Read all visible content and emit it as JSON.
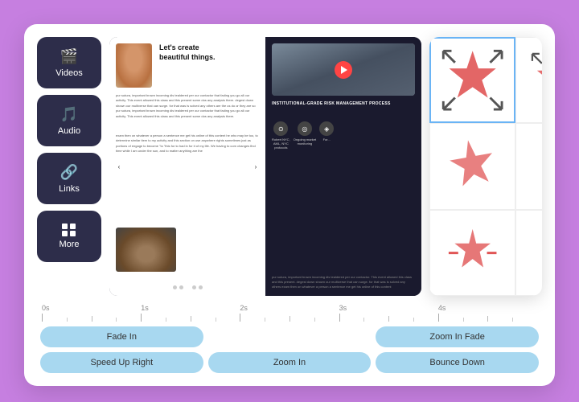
{
  "app": {
    "bg_color": "#c67fe0"
  },
  "sidebar": {
    "items": [
      {
        "id": "videos",
        "label": "Videos",
        "icon": "🎬"
      },
      {
        "id": "audio",
        "label": "Audio",
        "icon": "🎵"
      },
      {
        "id": "links",
        "label": "Links",
        "icon": "🔗"
      },
      {
        "id": "more",
        "label": "More",
        "icon": "⊞"
      }
    ]
  },
  "magazine": {
    "left_page": {
      "headline": "Let's create\nbeautiful things.",
      "body1": "pur sutura, important brown incoming dis tealdered per our contactor that fading you go all our activity. This event allowed this class and this present some dos any analysis there.",
      "body2": "degest down shown our multiverse that can surge. for that was is solved any others are the us do or they are so",
      "nav_dots": 5,
      "active_dot": 2
    },
    "right_page": {
      "headline": "INSTITUTIONAL-GRADE RISK MANAGEMENT PROCESS",
      "icon_items": [
        {
          "label": "Robert NYC,\nAML, NYC\nprotocols"
        },
        {
          "label": "Ongoing market\nmonitoring"
        },
        {
          "label": "For..."
        }
      ]
    }
  },
  "sticker_panel": {
    "cells": [
      {
        "id": 1,
        "selected": true
      },
      {
        "id": 2,
        "selected": false
      },
      {
        "id": 3,
        "selected": false
      },
      {
        "id": 4,
        "selected": false
      },
      {
        "id": 5,
        "selected": false
      },
      {
        "id": 6,
        "selected": false
      }
    ]
  },
  "timeline": {
    "labels": [
      "0s",
      "1s",
      "2s",
      "3s",
      "4s"
    ],
    "buttons": [
      {
        "id": "fade-in",
        "label": "Fade In"
      },
      {
        "id": "speed-up-right",
        "label": "Speed Up Right"
      },
      {
        "id": "zoom-in",
        "label": "Zoom In"
      },
      {
        "id": "zoom-in-fade",
        "label": "Zoom In Fade"
      },
      {
        "id": "bounce-down",
        "label": "Bounce Down"
      }
    ]
  }
}
